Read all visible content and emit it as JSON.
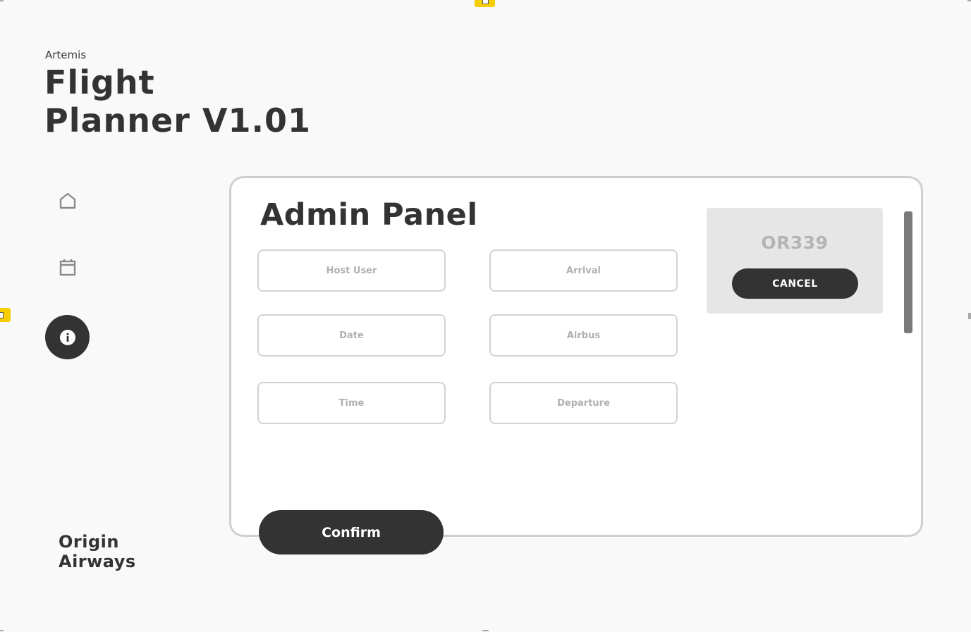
{
  "header": {
    "brand": "Artemis",
    "title_line1": "Flight",
    "title_line2": "Planner V1.01"
  },
  "sidebar": {
    "items": [
      {
        "icon": "home-icon",
        "active": false
      },
      {
        "icon": "calendar-icon",
        "active": false
      },
      {
        "icon": "info-icon",
        "active": true
      }
    ]
  },
  "footer": {
    "brand_line1": "Origin",
    "brand_line2": "Airways"
  },
  "panel": {
    "title": "Admin Panel",
    "fields": {
      "host_user": {
        "placeholder": "Host User",
        "value": ""
      },
      "arrival": {
        "placeholder": "Arrival",
        "value": ""
      },
      "date": {
        "placeholder": "Date",
        "value": ""
      },
      "airbus": {
        "placeholder": "Airbus",
        "value": ""
      },
      "time": {
        "placeholder": "Time",
        "value": ""
      },
      "departure": {
        "placeholder": "Departure",
        "value": ""
      }
    },
    "confirm_label": "Confirm"
  },
  "flight_card": {
    "code": "OR339",
    "cancel_label": "CANCEL"
  },
  "colors": {
    "background": "#f9f9f9",
    "dark": "#333333",
    "accent": "#f6cd00",
    "card": "#e6e6e6"
  }
}
